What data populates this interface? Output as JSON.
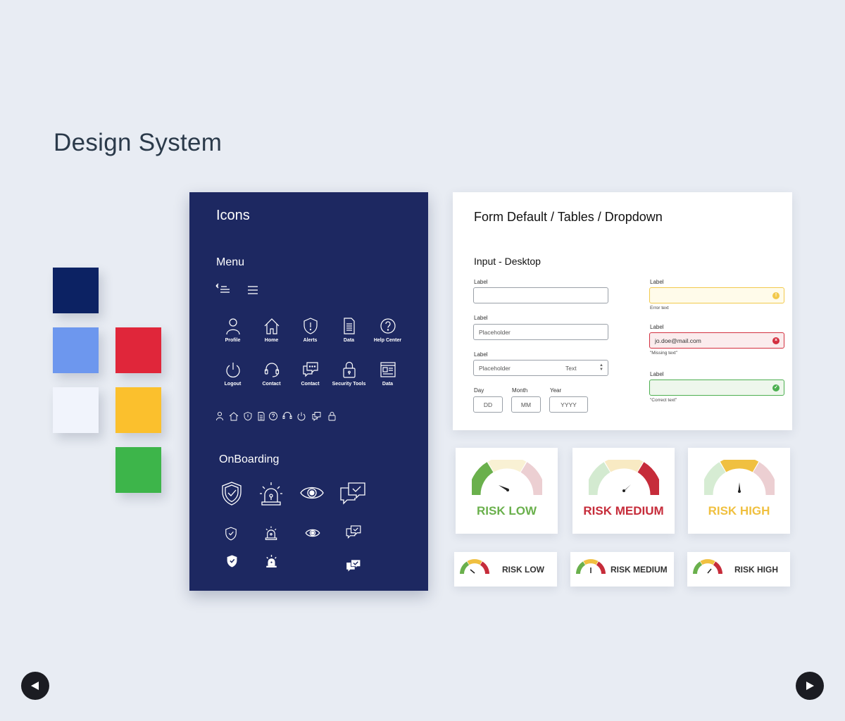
{
  "page": {
    "title": "Design System"
  },
  "palette": {
    "colors": [
      "#0c2263",
      "#6d97ee",
      "#f1f4fc",
      "#e0263a",
      "#fbc02d",
      "#3db54a"
    ]
  },
  "icons_panel": {
    "title": "Icons",
    "menu_heading": "Menu",
    "menu_icons": [
      {
        "icon": "user-icon",
        "label": "Profile"
      },
      {
        "icon": "home-icon",
        "label": "Home"
      },
      {
        "icon": "shield-alert-icon",
        "label": "Alerts"
      },
      {
        "icon": "document-icon",
        "label": "Data"
      },
      {
        "icon": "help-icon",
        "label": "Help Center"
      },
      {
        "icon": "power-icon",
        "label": "Logout"
      },
      {
        "icon": "headset-icon",
        "label": "Contact"
      },
      {
        "icon": "chat-icon",
        "label": "Contact"
      },
      {
        "icon": "lock-icon",
        "label": "Security Tools"
      },
      {
        "icon": "dashboard-icon",
        "label": "Data"
      }
    ],
    "onboarding_heading": "OnBoarding"
  },
  "form_panel": {
    "title": "Form Default / Tables / Dropdown",
    "subtitle": "Input - Desktop",
    "fields": {
      "label": "Label",
      "placeholder": "Placeholder",
      "dropdown_placeholder": "Placeholder",
      "dropdown_value": "Text",
      "warning_note": "Error text",
      "error_value": "jo.doe@mail.com",
      "error_note": "\"Missing text\"",
      "success_note": "\"Correct text\""
    },
    "date": {
      "day_label": "Day",
      "month_label": "Month",
      "year_label": "Year",
      "day_ph": "DD",
      "month_ph": "MM",
      "year_ph": "YYYY"
    },
    "colors": {
      "warning": "#f2c94c",
      "error": "#d32f3f",
      "success": "#4caf50"
    }
  },
  "risk_cards": {
    "large": [
      {
        "label": "RISK LOW",
        "color": "#6ab04c"
      },
      {
        "label": "RISK MEDIUM",
        "color": "#c62c3a"
      },
      {
        "label": "RISK HIGH",
        "color": "#f0c040"
      }
    ],
    "small": [
      {
        "label": "RISK LOW"
      },
      {
        "label": "RISK MEDIUM"
      },
      {
        "label": "RISK HIGH"
      }
    ]
  },
  "navigation": {
    "prev_icon": "arrow-left-icon",
    "next_icon": "arrow-right-icon"
  }
}
